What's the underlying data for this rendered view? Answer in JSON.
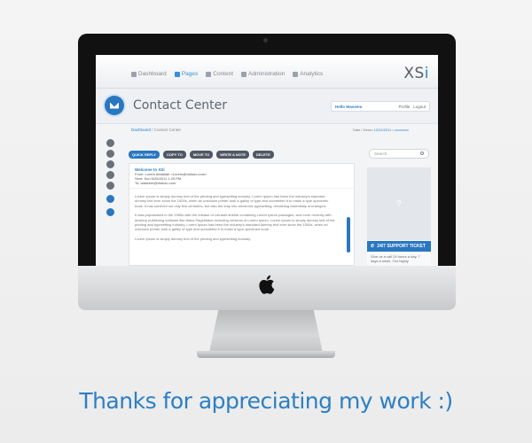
{
  "nav": {
    "items": [
      {
        "label": "Dashboard",
        "icon": "home-icon",
        "active": false
      },
      {
        "label": "Pages",
        "icon": "document-icon",
        "active": true
      },
      {
        "label": "Content",
        "icon": "content-icon",
        "active": false
      },
      {
        "label": "Administration",
        "icon": "user-icon",
        "active": false
      },
      {
        "label": "Analytics",
        "icon": "chart-icon",
        "active": false
      }
    ],
    "brand": "XS",
    "brand_accent": "i"
  },
  "header": {
    "title": "Contact Center",
    "icon": "envelope-icon",
    "user_greeting": "Hello Waseem",
    "profile_label": "Profile",
    "logout_label": "Logout"
  },
  "breadcrumb": {
    "root": "Dashboard",
    "separator": " / ",
    "current": "Contact Center"
  },
  "dateline": {
    "prefix": "Date / Demo",
    "value": "12/24/2011 • xxxxxxxx"
  },
  "toolbar": {
    "quick_reply": "QUICK REPLY",
    "copy_to": "COPY TO",
    "move_to": "MOVE TO",
    "write_note": "WRITE A NOTE",
    "delete": "DELETE"
  },
  "search": {
    "placeholder": "Search"
  },
  "message": {
    "subject": "Welcome to XSi",
    "from": "From: Lorem Abdallah <Lorem@visitulo.com>",
    "sent": "Sent: Sun 6/26/2011 1:29 PM",
    "to": "To:      waseem@visitulo.com",
    "paragraphs": [
      "Lorem Ipsum is simply dummy text of the printing and typesetting industry. Lorem Ipsum has been the industry's standard dummy text ever since the 1500s, when an unknown printer took a galley of type and scrambled it to make a type specimen book. It has survived not only five centuries, but also the leap into electronic typesetting, remaining essentially unchanged.",
      "It was popularised in the 1960s with the release of Letraset sheets containing Lorem Ipsum passages, and more recently with desktop publishing software like Aldus PageMaker including versions of Lorem Ipsum. Lorem Ipsum is simply dummy text of the printing and typesetting industry. Lorem Ipsum has been the industry's standard dummy text ever since the 1500s, when an unknown printer took a galley of type and scrambled it to make a type specimen book.",
      "Lorem Ipsum is simply dummy text of the printing and typesetting industry."
    ]
  },
  "side": {
    "placeholder": "?",
    "ticket_label": "24/7 SUPPORT TICKET",
    "ticket_text": "Give us a call 24 hours a day, 7 days a week. Our highly"
  },
  "footer": {
    "thanks": "Thanks for appreciating my work :)"
  },
  "colors": {
    "accent": "#2a77c0",
    "text_blue": "#2d7fc4",
    "dark_button": "#505963"
  }
}
